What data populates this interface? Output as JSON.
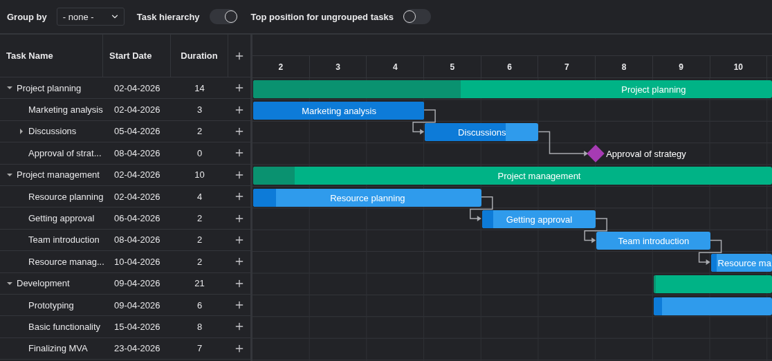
{
  "toolbar": {
    "group_by": {
      "label": "Group by",
      "value": "- none -"
    },
    "toggles": [
      {
        "label": "Task hierarchy",
        "on": true
      },
      {
        "label": "Top position for ungrouped tasks",
        "on": false
      }
    ]
  },
  "grid": {
    "columns": [
      "Task Name",
      "Start Date",
      "Duration"
    ]
  },
  "timeline": {
    "days": [
      "2",
      "3",
      "4",
      "5",
      "6",
      "7",
      "8",
      "9",
      "10"
    ]
  },
  "tasks": [
    {
      "name": "Project planning",
      "start_date": "02-04-2026",
      "duration": "14",
      "kind": "project",
      "expanded": true,
      "level": 0.4,
      "bar_label": "Project planning",
      "children": [
        {
          "name": "Marketing analysis",
          "start_date": "02-04-2026",
          "duration": "3",
          "kind": "task",
          "level": 1,
          "bar_label": "Marketing analysis"
        },
        {
          "name": "Discussions",
          "start_date": "05-04-2026",
          "duration": "2",
          "kind": "task",
          "expanded": false,
          "level": 0.71,
          "bar_label": "Discussions",
          "depends_on_previous": true
        },
        {
          "name": "Approval of strat...",
          "start_date": "08-04-2026",
          "duration": "0",
          "kind": "milestone",
          "bar_label": "Approval of strategy",
          "depends_on_previous": true
        }
      ]
    },
    {
      "name": "Project management",
      "start_date": "02-04-2026",
      "duration": "10",
      "kind": "project",
      "expanded": true,
      "level": 0.08,
      "bar_label": "Project management",
      "children": [
        {
          "name": "Resource planning",
          "start_date": "02-04-2026",
          "duration": "4",
          "kind": "task",
          "level": 0.1,
          "bar_label": "Resource planning"
        },
        {
          "name": "Getting approval",
          "start_date": "06-04-2026",
          "duration": "2",
          "kind": "task",
          "level": 0.1,
          "bar_label": "Getting approval",
          "depends_on_previous": true
        },
        {
          "name": "Team introduction",
          "start_date": "08-04-2026",
          "duration": "2",
          "kind": "task",
          "bar_label": "Team introduction",
          "depends_on_previous": true
        },
        {
          "name": "Resource manag...",
          "start_date": "10-04-2026",
          "duration": "2",
          "kind": "task",
          "level": 0.1,
          "bar_label": "Resource ma",
          "depends_on_previous": true
        }
      ]
    },
    {
      "name": "Development",
      "start_date": "09-04-2026",
      "duration": "21",
      "kind": "project",
      "expanded": true,
      "level": 0.02,
      "children": [
        {
          "name": "Prototyping",
          "start_date": "09-04-2026",
          "duration": "6",
          "kind": "task",
          "level": 0.07
        },
        {
          "name": "Basic functionality",
          "start_date": "15-04-2026",
          "duration": "8"
        },
        {
          "name": "Finalizing MVA",
          "start_date": "23-04-2026",
          "duration": "7"
        }
      ]
    }
  ]
}
